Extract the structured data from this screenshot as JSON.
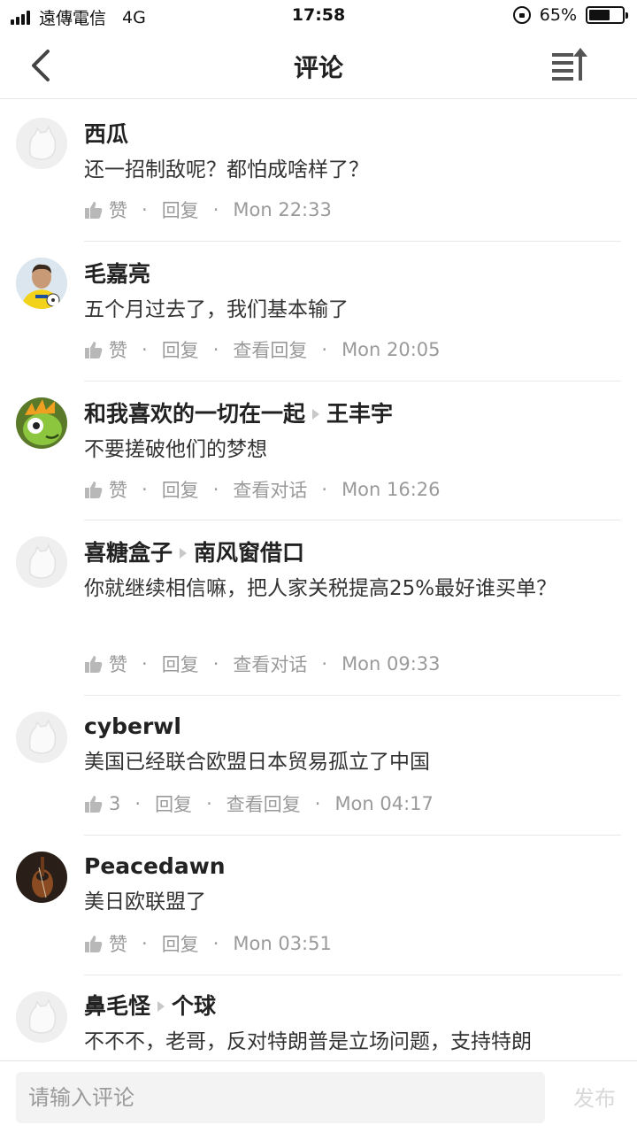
{
  "status_bar": {
    "carrier": "遠傳電信",
    "network": "4G",
    "time": "17:58",
    "battery": "65%",
    "battery_level": 0.65
  },
  "nav": {
    "title": "评论",
    "back_icon": "chevron-left-icon",
    "sort_icon": "sort-icon"
  },
  "labels": {
    "like": "赞",
    "reply": "回复",
    "separator": "·"
  },
  "comments": [
    {
      "name": "西瓜",
      "reply_to": "",
      "text": "还一招制敌呢？都怕成啥样了？",
      "likes": "赞",
      "reply": "回复",
      "extra": "",
      "time": "Mon 22:33",
      "avatar": "default"
    },
    {
      "name": "毛嘉亮",
      "reply_to": "",
      "text": "五个月过去了，我们基本输了",
      "likes": "赞",
      "reply": "回复",
      "extra": "查看回复",
      "time": "Mon 20:05",
      "avatar": "footballer"
    },
    {
      "name": "和我喜欢的一切在一起",
      "reply_to": "王丰宇",
      "text": "不要搓破他们的梦想",
      "likes": "赞",
      "reply": "回复",
      "extra": "查看对话",
      "time": "Mon 16:26",
      "avatar": "green-monster"
    },
    {
      "name": "喜糖盒子",
      "reply_to": "南风窗借口",
      "text": "你就继续相信嘛，把人家关税提高25%最好谁买单？",
      "likes": "赞",
      "reply": "回复",
      "extra": "查看对话",
      "time": "Mon 09:33",
      "avatar": "default"
    },
    {
      "name": "cyberwl",
      "reply_to": "",
      "text": "美国已经联合欧盟日本贸易孤立了中国",
      "likes": "3",
      "reply": "回复",
      "extra": "查看回复",
      "time": "Mon 04:17",
      "avatar": "default"
    },
    {
      "name": "Peacedawn",
      "reply_to": "",
      "text": "美日欧联盟了",
      "likes": "赞",
      "reply": "回复",
      "extra": "",
      "time": "Mon 03:51",
      "avatar": "violin"
    },
    {
      "name": "鼻毛怪",
      "reply_to": "个球",
      "text": "不不不，老哥，反对特朗普是立场问题，支持特朗",
      "likes": "",
      "reply": "",
      "extra": "",
      "time": "",
      "avatar": "default"
    }
  ],
  "input": {
    "placeholder": "请输入评论",
    "publish": "发布"
  }
}
